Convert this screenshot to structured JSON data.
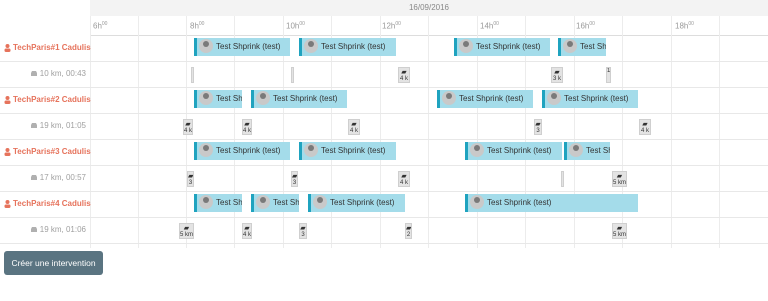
{
  "scheduler": {
    "date": "16/09/2016",
    "hours": [
      {
        "h": "6h",
        "sup": "00"
      },
      {
        "h": "8h",
        "sup": "00"
      },
      {
        "h": "10h",
        "sup": "00"
      },
      {
        "h": "12h",
        "sup": "00"
      },
      {
        "h": "14h",
        "sup": "00"
      },
      {
        "h": "16h",
        "sup": "00"
      },
      {
        "h": "18h",
        "sup": "00"
      }
    ],
    "resources": [
      {
        "name": "TechParis#1 Cadulis",
        "summary": "10 km, 00:43",
        "events": [
          {
            "label": "Test Shprink (test)"
          },
          {
            "label": "Test Shprink (test)"
          },
          {
            "label": "Test Shprink (test)"
          },
          {
            "label": "Test Shprink (test)"
          }
        ],
        "trips": [
          "",
          "",
          "4 k",
          "3 k",
          "1"
        ]
      },
      {
        "name": "TechParis#2 Cadulis",
        "summary": "19 km, 01:05",
        "events": [
          {
            "label": "Test Shprink (test)"
          },
          {
            "label": "Test Shprink (test)"
          },
          {
            "label": "Test Shprink (test)"
          },
          {
            "label": "Test Shprink (test)"
          }
        ],
        "trips": [
          "4 k",
          "4 k",
          "4 k",
          "3",
          "4 k"
        ]
      },
      {
        "name": "TechParis#3 Cadulis",
        "summary": "17 km, 00:57",
        "events": [
          {
            "label": "Test Shprink (test)"
          },
          {
            "label": "Test Shprink (test)"
          },
          {
            "label": "Test Shprink (test)"
          },
          {
            "label": "Test Shprink (test)"
          }
        ],
        "trips": [
          "3",
          "3",
          "4 k",
          "",
          "5 km"
        ]
      },
      {
        "name": "TechParis#4 Cadulis",
        "summary": "19 km, 01:06",
        "events": [
          {
            "label": "Test Shprink (test)"
          },
          {
            "label": "Test Shprink (test)"
          },
          {
            "label": "Test Shprink (test)"
          },
          {
            "label": "Test Shprink (test)"
          }
        ],
        "trips": [
          "5 km",
          "4 k",
          "3",
          "2",
          "5 km"
        ]
      }
    ]
  },
  "actions": {
    "create_label": "Créer une intervention"
  },
  "colors": {
    "event_bg": "#a4dcea",
    "event_accent": "#1fa3bf",
    "resource_name": "#e6735c",
    "button_bg": "#5a7481"
  },
  "icons": {
    "resource": "person-icon",
    "travel": "car-icon",
    "avatar": "avatar"
  }
}
